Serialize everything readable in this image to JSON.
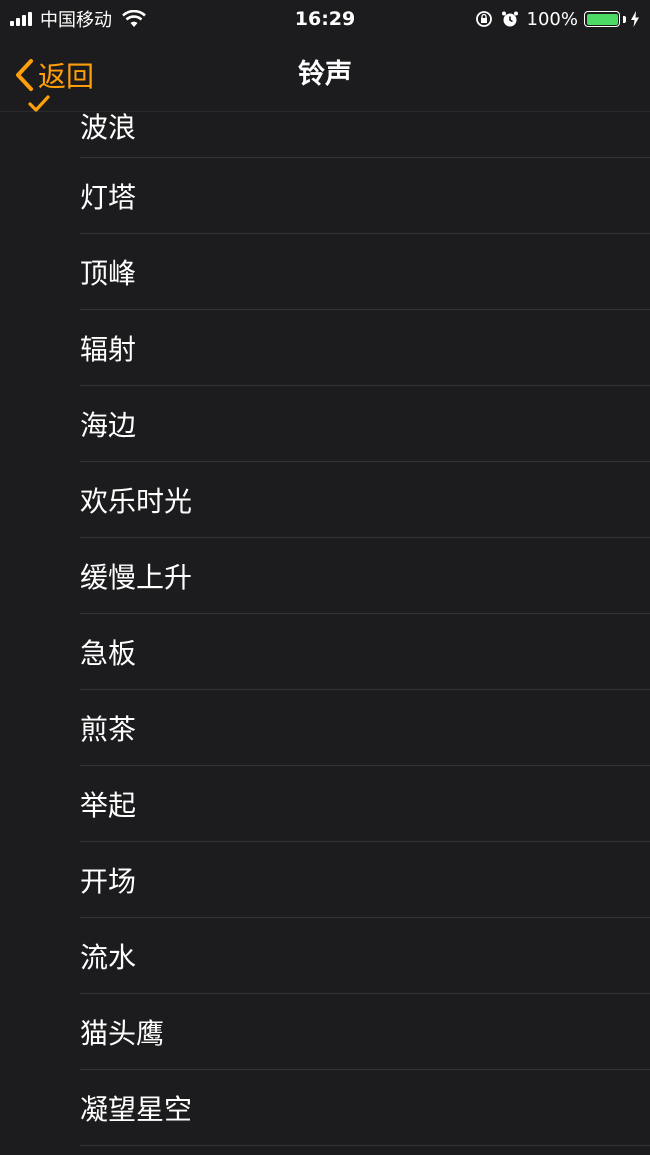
{
  "status_bar": {
    "carrier": "中国移动",
    "time": "16:29",
    "battery_percent": "100%",
    "battery_level": 1.0,
    "battery_color": "#4cd964",
    "icons": [
      "signal-icon",
      "wifi-icon",
      "rotation-lock-icon",
      "alarm-icon",
      "battery-icon",
      "charging-icon"
    ]
  },
  "nav": {
    "back_label": "返回",
    "title": "铃声",
    "accent_color": "#ff9f0a"
  },
  "ringtones": {
    "selected_index": 0,
    "items": [
      {
        "label": "波浪"
      },
      {
        "label": "灯塔"
      },
      {
        "label": "顶峰"
      },
      {
        "label": "辐射"
      },
      {
        "label": "海边"
      },
      {
        "label": "欢乐时光"
      },
      {
        "label": "缓慢上升"
      },
      {
        "label": "急板"
      },
      {
        "label": "煎茶"
      },
      {
        "label": "举起"
      },
      {
        "label": "开场"
      },
      {
        "label": "流水"
      },
      {
        "label": "猫头鹰"
      },
      {
        "label": "凝望星空"
      }
    ]
  }
}
